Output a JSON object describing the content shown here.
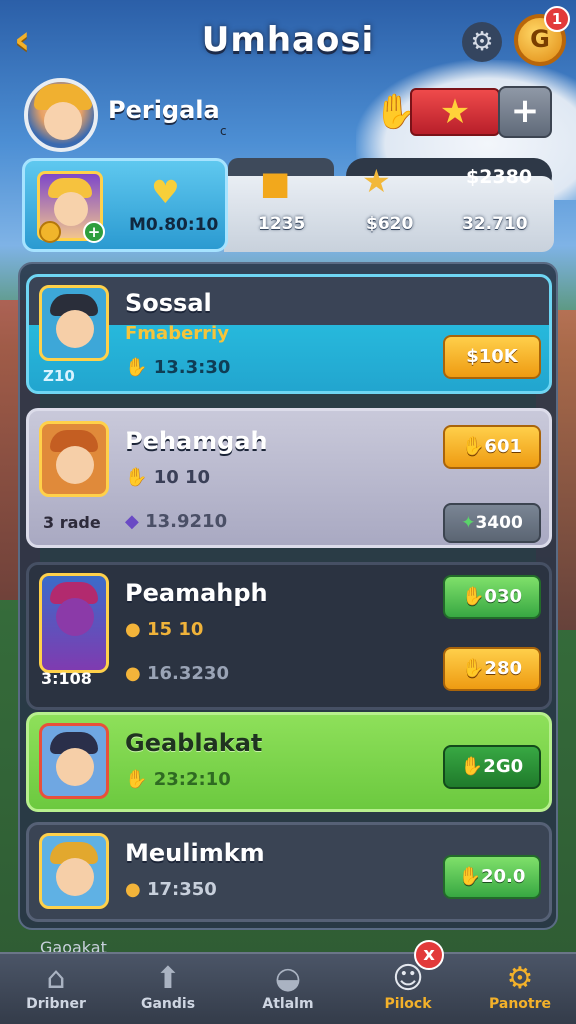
{
  "header": {
    "back_icon": "chevron-left-icon",
    "title": "Umhaosi",
    "settings_icon": "gear-icon",
    "coin_icon": "coin-icon",
    "coin_glyph": "G",
    "notification_count": "1"
  },
  "player": {
    "name": "Perigala",
    "note": "c",
    "hand_icon": "hand-icon",
    "star_icon": "star-icon",
    "add_label": "+"
  },
  "stats": {
    "player_value": "M0.80:10",
    "box1_value": "1235",
    "box2_value": "$620",
    "box3_value": "32.710",
    "money": "$2380"
  },
  "list": [
    {
      "name": "Sossal",
      "subtitle": "Fmaberriy",
      "corner_label": "Z10",
      "time": "13.3:30",
      "button": "$10K",
      "button_style": "gold"
    },
    {
      "name": "Pehamgah",
      "time": "10 10",
      "corner_label": "3 rade",
      "secondary_value": "13.9210",
      "button": "601",
      "button2": "3400",
      "button_style": "gold"
    },
    {
      "name": "Peamahph",
      "time": "15 10",
      "corner_label": "3:108",
      "secondary_value": "16.3230",
      "button": "030",
      "button2": "280",
      "button_style": "green"
    },
    {
      "name": "Geablakat",
      "time": "23:2:10",
      "button": "2G0",
      "button_style": "darkgreen"
    },
    {
      "name": "Meulimkm",
      "time": "17:350",
      "button": "20.0",
      "button_style": "green"
    }
  ],
  "peek_item": "Gaoakat",
  "bottom_nav": [
    {
      "label": "Dribner",
      "icon": "home-icon"
    },
    {
      "label": "Gandis",
      "icon": "upload-icon"
    },
    {
      "label": "Atlalm",
      "icon": "helmet-icon"
    },
    {
      "label": "Pilock",
      "icon": "character-icon",
      "badge": "x"
    },
    {
      "label": "Panotre",
      "icon": "gear-icon"
    }
  ],
  "colors": {
    "accent_gold": "#f3b12a",
    "highlight_blue": "#2b9ad1",
    "highlight_green": "#7fd856",
    "badge_red": "#e23a3a"
  }
}
